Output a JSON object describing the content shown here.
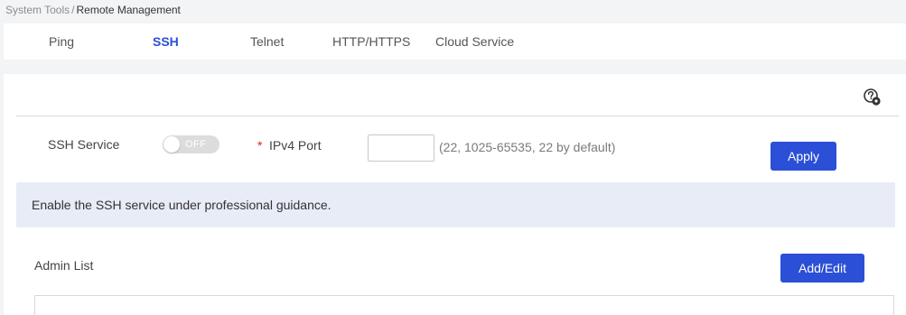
{
  "breadcrumb": {
    "parent": "System Tools",
    "separator": "/",
    "current": "Remote Management"
  },
  "tabs": [
    {
      "label": "Ping",
      "active": false
    },
    {
      "label": "SSH",
      "active": true
    },
    {
      "label": "Telnet",
      "active": false
    },
    {
      "label": "HTTP/HTTPS",
      "active": false
    },
    {
      "label": "Cloud Service",
      "active": false
    }
  ],
  "help": {
    "icon": "help-settings-icon"
  },
  "ssh_service": {
    "label": "SSH Service",
    "toggle_state": "OFF",
    "toggle_on": false
  },
  "ipv4_port": {
    "required_mark": "*",
    "label": "IPv4 Port",
    "value": "",
    "placeholder": "",
    "hint": "(22, 1025-65535, 22 by default)"
  },
  "apply_button": {
    "label": "Apply"
  },
  "notice": {
    "text": "Enable the SSH service under professional guidance."
  },
  "admin_list": {
    "title": "Admin List",
    "add_edit_label": "Add/Edit"
  },
  "colors": {
    "accent": "#2b4fd6",
    "notice_bg": "#e8ecf7",
    "required": "#e02020",
    "toggle_off": "#dcdcdc"
  }
}
